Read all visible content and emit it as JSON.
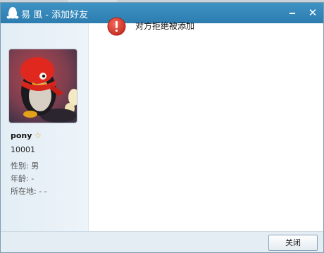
{
  "window": {
    "title": "易 風 - 添加好友",
    "minimize_icon": "minimize-icon",
    "close_icon": "close-icon"
  },
  "profile": {
    "avatar_icon": "qq-penguin-avatar",
    "name": "pony",
    "badge": "☆",
    "qq_number": "10001",
    "sex": "性别: 男",
    "age": "年龄: -",
    "location": "所在地: -   -"
  },
  "message": {
    "icon": "error-icon",
    "text": "对方拒绝被添加"
  },
  "footer": {
    "close_label": "关闭"
  },
  "colors": {
    "titlebar": "#2c7cb0",
    "error": "#d8382b",
    "sidebar": "#e2edf5"
  }
}
